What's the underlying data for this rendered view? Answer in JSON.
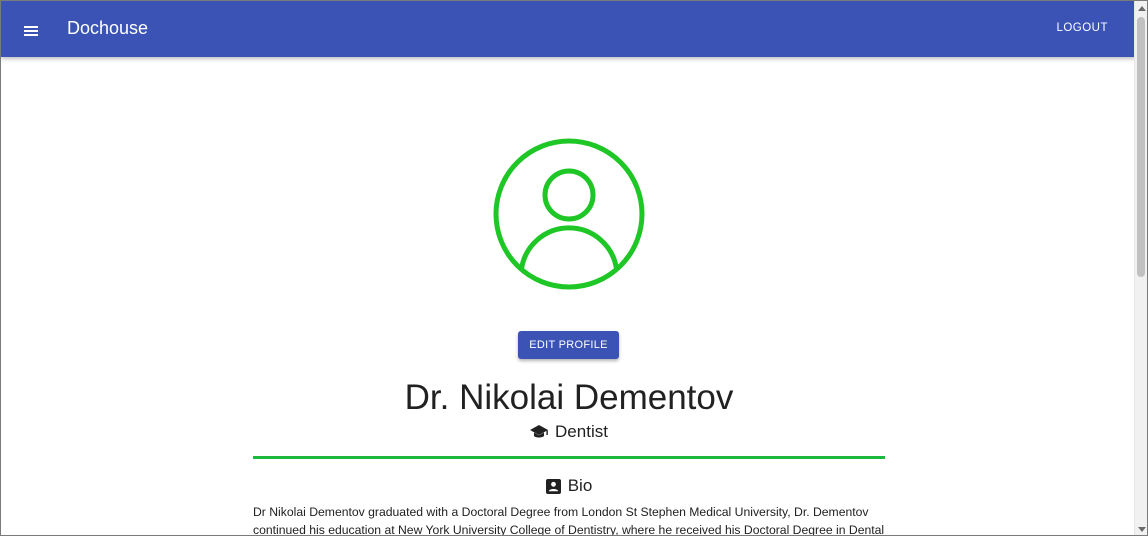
{
  "appbar": {
    "brand": "Dochouse",
    "logout_label": "LOGOUT",
    "color": "#3a53b5"
  },
  "profile": {
    "avatar_icon": "account-circle-icon",
    "avatar_color": "#1ec626",
    "edit_label": "EDIT PROFILE",
    "name": "Dr. Nikolai Dementov",
    "specialty_icon": "graduation-cap-icon",
    "specialty": "Dentist",
    "divider_color": "#1db83e"
  },
  "bio": {
    "icon": "contact-card-icon",
    "heading": "Bio",
    "line1": "Dr Nikolai Dementov graduated with a Doctoral Degree from London St Stephen Medical University, Dr. Dementov",
    "line2": "continued his education at New York University College of Dentistry, where he received his Doctoral Degree in Dental"
  }
}
